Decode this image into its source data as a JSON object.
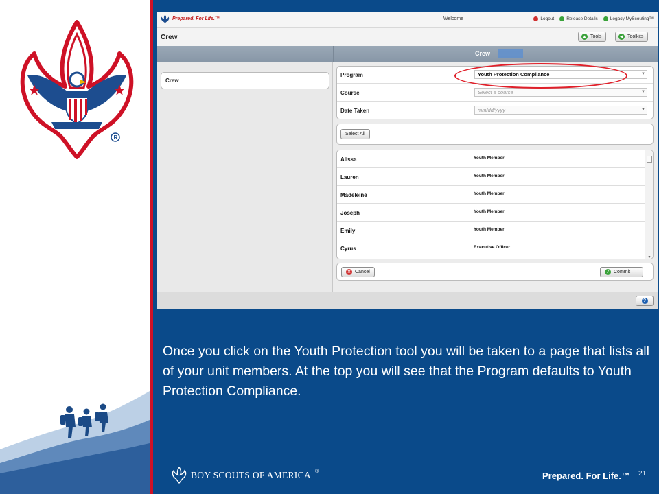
{
  "screenshot": {
    "brand_tagline": "Prepared. For Life.™",
    "welcome": "Welcome",
    "top_links": [
      "Logout",
      "Release Details",
      "Legacy MyScouting™"
    ],
    "tab_title": "Crew",
    "tool_buttons": [
      "Tools",
      "Toolkits"
    ],
    "pane_title": "Crew",
    "left_list": [
      "Crew"
    ],
    "form": {
      "program_label": "Program",
      "program_value": "Youth Protection Compliance",
      "course_label": "Course",
      "course_placeholder": "Select a course",
      "date_label": "Date Taken",
      "date_placeholder": "mm/dd/yyyy"
    },
    "select_all": "Select All",
    "members": [
      {
        "name": "Alissa",
        "role": "Youth Member"
      },
      {
        "name": "Lauren",
        "role": "Youth Member"
      },
      {
        "name": "Madeleine",
        "role": "Youth Member"
      },
      {
        "name": "Joseph",
        "role": "Youth Member"
      },
      {
        "name": "Emily",
        "role": "Youth Member"
      },
      {
        "name": "Cyrus",
        "role": "Executive Officer"
      }
    ],
    "cancel": "Cancel",
    "commit": "Commit",
    "help_icon": "help-icon"
  },
  "caption": "Once you click on the Youth Protection tool you will be taken to a page that lists all of your unit members. At the top you will see that the Program defaults to Youth Protection Compliance.",
  "footer": {
    "org": "BOY SCOUTS OF AMERICA",
    "trademark": "®",
    "motto": "Prepared. For Life.™",
    "slide_number": "21"
  },
  "colors": {
    "blue": "#0a4a8a",
    "red": "#ce1126",
    "highlight": "#e0202a"
  }
}
